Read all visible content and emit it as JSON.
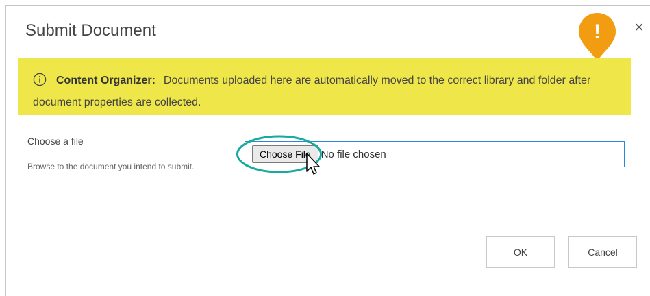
{
  "dialog": {
    "title": "Submit Document",
    "close_glyph": "×"
  },
  "banner": {
    "label": "Content Organizer:",
    "message": "Documents uploaded here are automatically moved to the correct library and folder after document properties are collected.",
    "background": "#efe649",
    "icon": "info-icon"
  },
  "marker": {
    "glyph": "!",
    "color": "#f29c11",
    "icon": "exclamation-marker-icon"
  },
  "file_field": {
    "label": "Choose a file",
    "help": "Browse to the document you intend to submit.",
    "button_label": "Choose File",
    "status": "No file chosen",
    "ring_color": "#1aa9a0"
  },
  "actions": {
    "ok_label": "OK",
    "cancel_label": "Cancel"
  }
}
